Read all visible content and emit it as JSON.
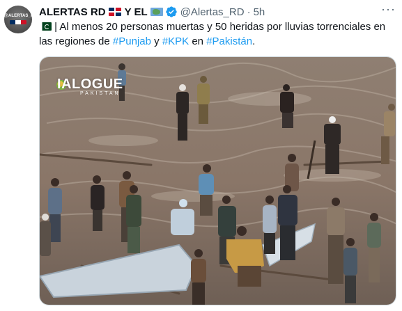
{
  "tweet": {
    "author": {
      "name_part1": "ALERTAS RD",
      "name_part2": "Y EL",
      "handle": "@Alertas_RD",
      "time": "5h",
      "separator": "·",
      "avatar_text": "@ALERTAS_RD",
      "verified_color": "#1d9bf0"
    },
    "more_label": "···",
    "text": {
      "part1": " | Al menos 20 personas muertas y 50 heridas por lluvias torrenciales en las regiones de ",
      "tag1": "#Punjab",
      "part2": " y ",
      "tag2": "#KPK",
      "part3": " en ",
      "tag3": "#Pakistán",
      "part4": "."
    },
    "media": {
      "watermark": "IALOGUE",
      "watermark_sub": "PAKISTAN"
    }
  },
  "colors": {
    "link": "#1d9bf0",
    "muted": "#536471",
    "text": "#0f1419",
    "flood_water": "#8a7a6c"
  }
}
